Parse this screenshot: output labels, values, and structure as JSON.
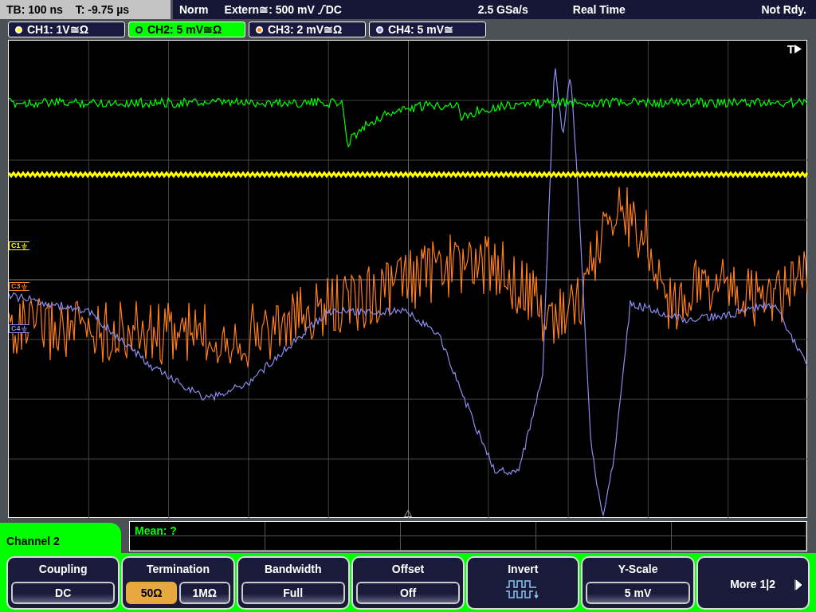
{
  "status_bar": {
    "timebase": "TB: 100 ns",
    "trigger_time": "T: -9.75 µs",
    "trigger_mode": "Norm",
    "trigger_source": "Extern≅: 500 mV",
    "trigger_coupling": "DC",
    "sample_rate": "2.5 GSa/s",
    "acquisition": "Real Time",
    "state": "Not Rdy."
  },
  "channels": [
    {
      "label": "CH1: 1V≅Ω",
      "color": "#ffff00",
      "selected": false
    },
    {
      "label": "CH2: 5 mV≅Ω",
      "color": "#00ff00",
      "selected": true
    },
    {
      "label": "CH3: 2 mV≅Ω",
      "color": "#ff7f1e",
      "selected": false
    },
    {
      "label": "CH4: 5 mV≅",
      "color": "#8c8cf0",
      "selected": false
    }
  ],
  "markers": [
    {
      "label": "C1",
      "color": "#ffff00"
    },
    {
      "label": "C3",
      "color": "#ff7f1e"
    },
    {
      "label": "C4",
      "color": "#8c8cf0"
    }
  ],
  "trigger_marker": "T",
  "measurement": "Mean: ?",
  "menu": {
    "title": "Channel 2",
    "buttons": [
      {
        "kind": "select",
        "label": "Coupling",
        "value": "DC"
      },
      {
        "kind": "toggle",
        "label": "Termination",
        "options": [
          {
            "label": "50Ω",
            "selected": true
          },
          {
            "label": "1MΩ",
            "selected": false
          }
        ]
      },
      {
        "kind": "select",
        "label": "Bandwidth",
        "value": "Full"
      },
      {
        "kind": "select",
        "label": "Offset",
        "value": "Off"
      },
      {
        "kind": "icon",
        "label": "Invert"
      },
      {
        "kind": "select",
        "label": "Y-Scale",
        "value": "5 mV"
      },
      {
        "kind": "more",
        "label": "More 1|2"
      }
    ]
  }
}
